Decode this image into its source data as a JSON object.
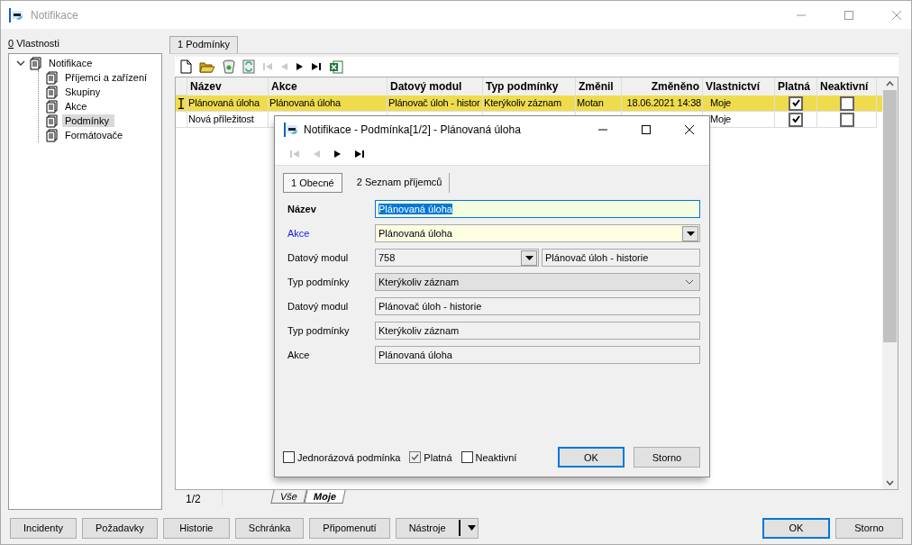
{
  "window": {
    "title": "Notifikace"
  },
  "properties": {
    "label": "0 Vlastnosti"
  },
  "tree": [
    {
      "label": "Notifikace",
      "expanded": true,
      "selected": false,
      "children": [
        {
          "label": "Příjemci a zařízení",
          "selected": false
        },
        {
          "label": "Skupiny",
          "selected": false
        },
        {
          "label": "Akce",
          "selected": false
        },
        {
          "label": "Podmínky",
          "selected": true
        },
        {
          "label": "Formátovače",
          "selected": false
        }
      ]
    }
  ],
  "tabs": [
    {
      "label": "1 Podmínky",
      "selected": true
    }
  ],
  "toolbar": [
    {
      "kind": "new",
      "disabled": false
    },
    {
      "kind": "open",
      "disabled": false
    },
    {
      "kind": "delete",
      "disabled": false
    },
    {
      "kind": "refresh",
      "disabled": false
    },
    {
      "kind": "first",
      "disabled": true
    },
    {
      "kind": "prev",
      "disabled": true
    },
    {
      "kind": "next",
      "disabled": false
    },
    {
      "kind": "last",
      "disabled": false
    },
    {
      "kind": "excel",
      "disabled": false
    }
  ],
  "table": {
    "columns": [
      "Název",
      "Akce",
      "Datový modul",
      "Typ podmínky",
      "Změnil",
      "Změněno",
      "Vlastnictví",
      "Platná",
      "Neaktivní"
    ],
    "rows": [
      {
        "selected": true,
        "cells": [
          "Plánovaná úloha",
          "Plánovaná úloha",
          "Plánovač úloh - histor",
          "Kterýkoliv záznam",
          "Motan",
          "18.06.2021 14:38",
          "Moje"
        ],
        "platna": true,
        "neaktivni": false
      },
      {
        "selected": false,
        "cells": [
          "Nová příležitost",
          null,
          null,
          null,
          null,
          null,
          "Moje"
        ],
        "platna": true,
        "neaktivni": false
      }
    ]
  },
  "status_bar": {
    "position": "1/2",
    "filters": [
      {
        "label": "Vše",
        "selected": false
      },
      {
        "label": "Moje",
        "selected": true
      }
    ]
  },
  "bottom_buttons": [
    {
      "label": "Incidenty",
      "kind": "plain"
    },
    {
      "label": "Požadavky",
      "kind": "plain"
    },
    {
      "label": "Historie",
      "kind": "plain"
    },
    {
      "label": "Schránka",
      "kind": "plain"
    },
    {
      "label": "Připomenutí",
      "kind": "plain"
    },
    {
      "label": "Nástroje",
      "kind": "split"
    }
  ],
  "dialog_buttons": [
    {
      "label": "OK",
      "default": true
    },
    {
      "label": "Storno",
      "default": false
    }
  ],
  "dialog": {
    "title": "Notifikace - Podmínka[1/2] - Plánovaná úloha",
    "nav": [
      {
        "kind": "first",
        "disabled": true
      },
      {
        "kind": "prev",
        "disabled": true
      },
      {
        "kind": "next",
        "disabled": false
      },
      {
        "kind": "last",
        "disabled": false
      }
    ],
    "tabs": [
      {
        "label": "1 Obecné",
        "selected": true
      },
      {
        "label": "2 Seznam příjemců",
        "selected": false
      }
    ],
    "fields": [
      {
        "label": "Název",
        "label_bold": true,
        "label_link": false,
        "kind": "text",
        "value": "Plánovaná úloha",
        "text_selected": true
      },
      {
        "label": "Akce",
        "label_bold": false,
        "label_link": true,
        "kind": "combo",
        "value": "Plánovaná úloha"
      },
      {
        "label": "Datový modul",
        "label_bold": false,
        "label_link": false,
        "kind": "code_combo",
        "value": "758",
        "detail": "Plánovač úloh - historie"
      },
      {
        "label": "Typ podmínky",
        "label_bold": false,
        "label_link": false,
        "kind": "select",
        "value": "Kterýkoliv záznam"
      },
      {
        "label": "Datový modul",
        "label_bold": false,
        "label_link": false,
        "kind": "readonly",
        "value": "Plánovač úloh - historie"
      },
      {
        "label": "Typ podmínky",
        "label_bold": false,
        "label_link": false,
        "kind": "readonly",
        "value": "Kterýkoliv záznam"
      },
      {
        "label": "Akce",
        "label_bold": false,
        "label_link": false,
        "kind": "readonly",
        "value": "Plánovaná úloha"
      }
    ],
    "checkboxes": [
      {
        "label": "Jednorázová podmínka",
        "checked": false
      },
      {
        "label": "Platná",
        "checked": true
      },
      {
        "label": "Neaktivní",
        "checked": false
      }
    ],
    "buttons": [
      {
        "label": "OK",
        "default": true
      },
      {
        "label": "Storno",
        "default": false
      }
    ]
  }
}
